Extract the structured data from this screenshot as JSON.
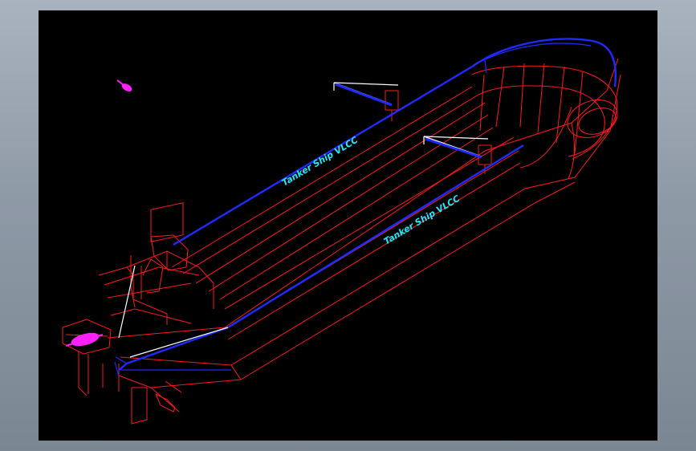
{
  "labels": {
    "hull_label_port": "Tanker Ship VLCC",
    "hull_label_starboard": "Tanker Ship VLCC"
  },
  "colors": {
    "background": "#000000",
    "frame": "#8e99a6",
    "hull_lines": "#ff1a1a",
    "deck_edge": "#1f2bff",
    "label": "#24e8ff",
    "cranes": "#ffffff",
    "ucs_marker": "#ff22ff"
  },
  "icons": {
    "ucs": "ucs-icon"
  }
}
